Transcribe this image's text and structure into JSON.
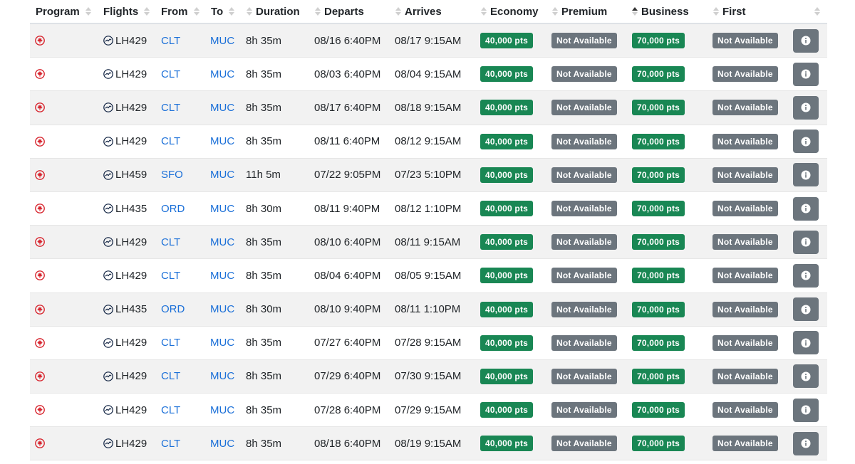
{
  "header": {
    "program": "Program",
    "flights": "Flights",
    "from": "From",
    "to": "To",
    "duration": "Duration",
    "departs": "Departs",
    "arrives": "Arrives",
    "economy": "Economy",
    "premium": "Premium",
    "business": "Business",
    "first": "First"
  },
  "colors": {
    "available": "#198754",
    "unavailable": "#6c757d",
    "link": "#1a6fd8",
    "program_logo": "#d7262f"
  },
  "icons": {
    "program": "air-canada-maple-leaf-icon",
    "flight": "lufthansa-crane-icon",
    "details": "info-icon"
  },
  "rows": [
    {
      "flight": "LH429",
      "from": "CLT",
      "to": "MUC",
      "duration": "8h 35m",
      "departs": "08/16 6:40PM",
      "arrives": "08/17 9:15AM",
      "economy": "40,000 pts",
      "premium": "Not Available",
      "business": "70,000 pts",
      "first": "Not Available"
    },
    {
      "flight": "LH429",
      "from": "CLT",
      "to": "MUC",
      "duration": "8h 35m",
      "departs": "08/03 6:40PM",
      "arrives": "08/04 9:15AM",
      "economy": "40,000 pts",
      "premium": "Not Available",
      "business": "70,000 pts",
      "first": "Not Available"
    },
    {
      "flight": "LH429",
      "from": "CLT",
      "to": "MUC",
      "duration": "8h 35m",
      "departs": "08/17 6:40PM",
      "arrives": "08/18 9:15AM",
      "economy": "40,000 pts",
      "premium": "Not Available",
      "business": "70,000 pts",
      "first": "Not Available"
    },
    {
      "flight": "LH429",
      "from": "CLT",
      "to": "MUC",
      "duration": "8h 35m",
      "departs": "08/11 6:40PM",
      "arrives": "08/12 9:15AM",
      "economy": "40,000 pts",
      "premium": "Not Available",
      "business": "70,000 pts",
      "first": "Not Available"
    },
    {
      "flight": "LH459",
      "from": "SFO",
      "to": "MUC",
      "duration": "11h 5m",
      "departs": "07/22 9:05PM",
      "arrives": "07/23 5:10PM",
      "economy": "40,000 pts",
      "premium": "Not Available",
      "business": "70,000 pts",
      "first": "Not Available"
    },
    {
      "flight": "LH435",
      "from": "ORD",
      "to": "MUC",
      "duration": "8h 30m",
      "departs": "08/11 9:40PM",
      "arrives": "08/12 1:10PM",
      "economy": "40,000 pts",
      "premium": "Not Available",
      "business": "70,000 pts",
      "first": "Not Available"
    },
    {
      "flight": "LH429",
      "from": "CLT",
      "to": "MUC",
      "duration": "8h 35m",
      "departs": "08/10 6:40PM",
      "arrives": "08/11 9:15AM",
      "economy": "40,000 pts",
      "premium": "Not Available",
      "business": "70,000 pts",
      "first": "Not Available"
    },
    {
      "flight": "LH429",
      "from": "CLT",
      "to": "MUC",
      "duration": "8h 35m",
      "departs": "08/04 6:40PM",
      "arrives": "08/05 9:15AM",
      "economy": "40,000 pts",
      "premium": "Not Available",
      "business": "70,000 pts",
      "first": "Not Available"
    },
    {
      "flight": "LH435",
      "from": "ORD",
      "to": "MUC",
      "duration": "8h 30m",
      "departs": "08/10 9:40PM",
      "arrives": "08/11 1:10PM",
      "economy": "40,000 pts",
      "premium": "Not Available",
      "business": "70,000 pts",
      "first": "Not Available"
    },
    {
      "flight": "LH429",
      "from": "CLT",
      "to": "MUC",
      "duration": "8h 35m",
      "departs": "07/27 6:40PM",
      "arrives": "07/28 9:15AM",
      "economy": "40,000 pts",
      "premium": "Not Available",
      "business": "70,000 pts",
      "first": "Not Available"
    },
    {
      "flight": "LH429",
      "from": "CLT",
      "to": "MUC",
      "duration": "8h 35m",
      "departs": "07/29 6:40PM",
      "arrives": "07/30 9:15AM",
      "economy": "40,000 pts",
      "premium": "Not Available",
      "business": "70,000 pts",
      "first": "Not Available"
    },
    {
      "flight": "LH429",
      "from": "CLT",
      "to": "MUC",
      "duration": "8h 35m",
      "departs": "07/28 6:40PM",
      "arrives": "07/29 9:15AM",
      "economy": "40,000 pts",
      "premium": "Not Available",
      "business": "70,000 pts",
      "first": "Not Available"
    },
    {
      "flight": "LH429",
      "from": "CLT",
      "to": "MUC",
      "duration": "8h 35m",
      "departs": "08/18 6:40PM",
      "arrives": "08/19 9:15AM",
      "economy": "40,000 pts",
      "premium": "Not Available",
      "business": "70,000 pts",
      "first": "Not Available"
    }
  ]
}
